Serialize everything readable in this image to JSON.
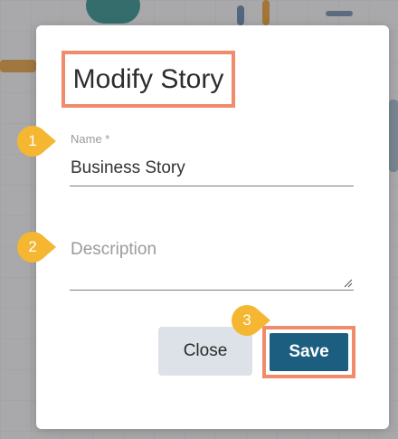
{
  "dialog": {
    "title": "Modify Story",
    "name_label": "Name *",
    "name_value": "Business Story",
    "description_placeholder": "Description",
    "close_label": "Close",
    "save_label": "Save"
  },
  "steps": [
    "1",
    "2",
    "3"
  ],
  "colors": {
    "highlight": "#f08b6c",
    "marker": "#f5b731",
    "save_button": "#1b5e80",
    "close_button": "#dde2e8"
  }
}
